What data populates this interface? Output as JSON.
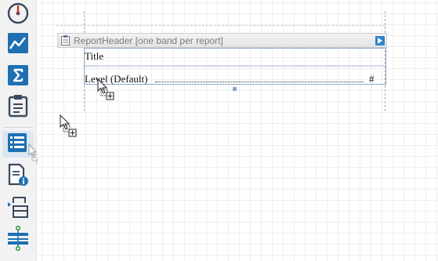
{
  "toolbar": {
    "items": [
      {
        "name": "dashboard-icon",
        "color": "#c0392b"
      },
      {
        "name": "chart-line-icon",
        "color": "#1f6fb2"
      },
      {
        "name": "summary-sigma-icon",
        "color": "#1f6fb2"
      },
      {
        "name": "clipboard-icon",
        "color": "#3a4a5c"
      },
      {
        "name": "list-report-icon",
        "color": "#1f6fb2",
        "active": true
      },
      {
        "name": "document-info-icon",
        "color": "#1f6fb2"
      },
      {
        "name": "page-layout-icon",
        "color": "#3a4a5c"
      },
      {
        "name": "band-split-icon",
        "color": "#1f6fb2"
      }
    ]
  },
  "band": {
    "header_title": "ReportHeader [one band per report]",
    "expand_icon": "chevron-right-icon"
  },
  "fields": {
    "title": "Title",
    "level": "Level (Default)",
    "page_number": "#"
  }
}
